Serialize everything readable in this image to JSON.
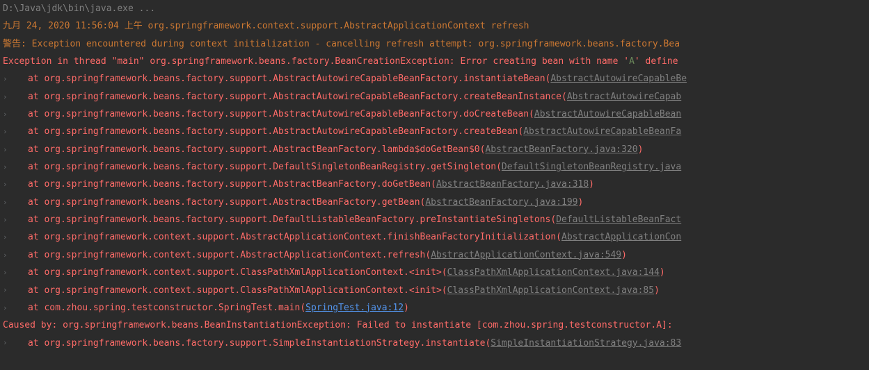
{
  "command": "D:\\Java\\jdk\\bin\\java.exe ...",
  "log_timestamp": "九月 24, 2020 11:56:04 上午 org.springframework.context.support.AbstractApplicationContext refresh",
  "warning_line": "警告: Exception encountered during context initialization - cancelling refresh attempt: org.springframework.beans.factory.Bea",
  "exception_prefix": "Exception in thread \"main\" org.springframework.beans.factory.BeanCreationException: Error creating bean with name '",
  "exception_bean": "A",
  "exception_suffix": "' define",
  "trace": [
    {
      "method": "at org.springframework.beans.factory.support.AbstractAutowireCapableBeanFactory.instantiateBean(",
      "file": "AbstractAutowireCapableBe",
      "close": ""
    },
    {
      "method": "at org.springframework.beans.factory.support.AbstractAutowireCapableBeanFactory.createBeanInstance(",
      "file": "AbstractAutowireCapab",
      "close": ""
    },
    {
      "method": "at org.springframework.beans.factory.support.AbstractAutowireCapableBeanFactory.doCreateBean(",
      "file": "AbstractAutowireCapableBean",
      "close": ""
    },
    {
      "method": "at org.springframework.beans.factory.support.AbstractAutowireCapableBeanFactory.createBean(",
      "file": "AbstractAutowireCapableBeanFa",
      "close": ""
    },
    {
      "method": "at org.springframework.beans.factory.support.AbstractBeanFactory.lambda$doGetBean$0(",
      "file": "AbstractBeanFactory.java:320",
      "close": ")"
    },
    {
      "method": "at org.springframework.beans.factory.support.DefaultSingletonBeanRegistry.getSingleton(",
      "file": "DefaultSingletonBeanRegistry.java",
      "close": ""
    },
    {
      "method": "at org.springframework.beans.factory.support.AbstractBeanFactory.doGetBean(",
      "file": "AbstractBeanFactory.java:318",
      "close": ")"
    },
    {
      "method": "at org.springframework.beans.factory.support.AbstractBeanFactory.getBean(",
      "file": "AbstractBeanFactory.java:199",
      "close": ")"
    },
    {
      "method": "at org.springframework.beans.factory.support.DefaultListableBeanFactory.preInstantiateSingletons(",
      "file": "DefaultListableBeanFact",
      "close": ""
    },
    {
      "method": "at org.springframework.context.support.AbstractApplicationContext.finishBeanFactoryInitialization(",
      "file": "AbstractApplicationCon",
      "close": ""
    },
    {
      "method": "at org.springframework.context.support.AbstractApplicationContext.refresh(",
      "file": "AbstractApplicationContext.java:549",
      "close": ")"
    },
    {
      "method": "at org.springframework.context.support.ClassPathXmlApplicationContext.<init>(",
      "file": "ClassPathXmlApplicationContext.java:144",
      "close": ")"
    },
    {
      "method": "at org.springframework.context.support.ClassPathXmlApplicationContext.<init>(",
      "file": "ClassPathXmlApplicationContext.java:85",
      "close": ")"
    },
    {
      "method": "at com.zhou.spring.testconstructor.SpringTest.main(",
      "file": "SpringTest.java:12",
      "close": ")",
      "blue": true
    }
  ],
  "caused_by": "Caused by: org.springframework.beans.BeanInstantiationException: Failed to instantiate [com.zhou.spring.testconstructor.A]:",
  "last": {
    "method": "at org.springframework.beans.factory.support.SimpleInstantiationStrategy.instantiate(",
    "file": "SimpleInstantiationStrategy.java:83",
    "close": ""
  }
}
